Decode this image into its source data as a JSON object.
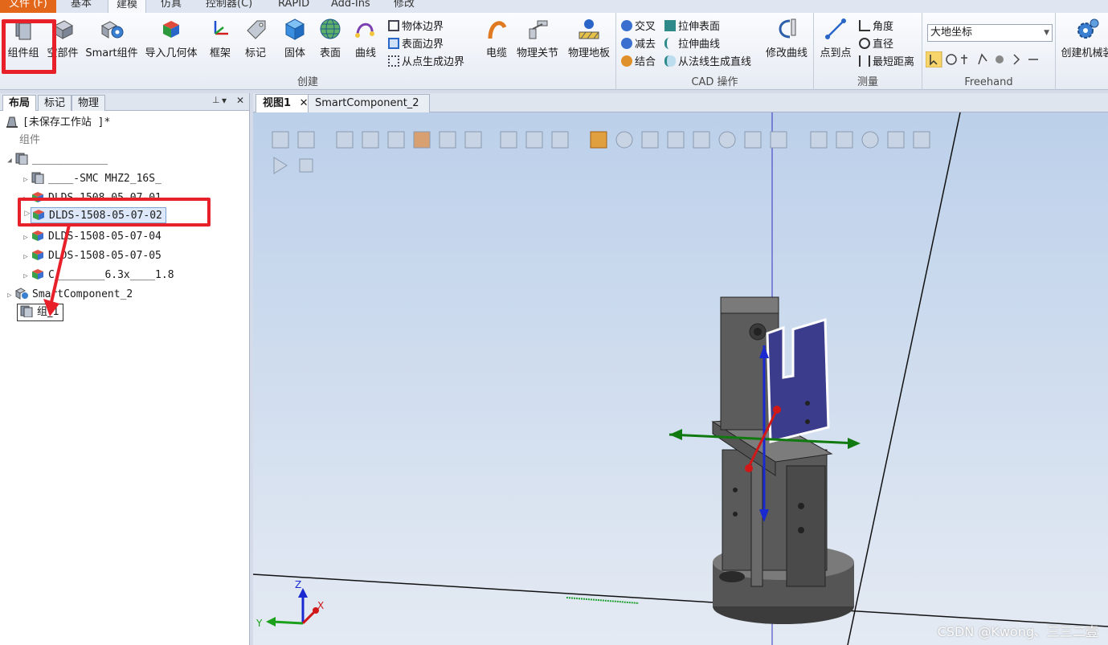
{
  "menu_tabs": [
    {
      "label": "文件 (F)"
    },
    {
      "label": "基本"
    },
    {
      "label": "建模"
    },
    {
      "label": "仿真"
    },
    {
      "label": "控制器(C)"
    },
    {
      "label": "RAPID"
    },
    {
      "label": "Add-Ins"
    },
    {
      "label": "修改"
    }
  ],
  "ribbon": {
    "create": {
      "label": "创建",
      "buttons": [
        "组件组",
        "空部件",
        "Smart组件",
        "导入几何体",
        "框架",
        "标记",
        "固体",
        "表面",
        "曲线"
      ],
      "small": [
        "物体边界",
        "表面边界",
        "从点生成边界"
      ],
      "physics": [
        "电缆",
        "物理关节",
        "物理地板"
      ]
    },
    "cad": {
      "label": "CAD 操作",
      "small_left": [
        "交叉",
        "减去",
        "结合"
      ],
      "small_right": [
        "拉伸表面",
        "拉伸曲线",
        "从法线生成直线"
      ],
      "modify": "修改曲线"
    },
    "measure": {
      "label": "测量",
      "point_to_point": "点到点",
      "small": [
        "角度",
        "直径",
        "最短距离"
      ]
    },
    "freehand": {
      "label": "Freehand",
      "coord_select": "大地坐标"
    },
    "mechanism": "创建机械装"
  },
  "left_panel": {
    "tabs": [
      "布局",
      "标记",
      "物理"
    ],
    "pin": "▾",
    "pin_extra": "⊥",
    "close": "✕",
    "tree": {
      "station": "[未保存工作站 ]*",
      "components_label": "组件",
      "group_node": "____________",
      "children": [
        "____-SMC MHZ2_16S_",
        "DLDS-1508-05-07-01",
        "DLDS-1508-05-07-02",
        "DLDS-1508-05-07-04",
        "DLDS-1508-05-07-05",
        "C________6.3x____1.8"
      ],
      "smart_component": "SmartComponent_2",
      "new_group": "组_1"
    }
  },
  "view_tabs": [
    {
      "label": "视图1"
    },
    {
      "label": "SmartComponent_2"
    }
  ],
  "view_tab_close": "✕",
  "axis_labels": {
    "x": "X",
    "y": "Y",
    "z": "Z"
  },
  "watermark": "CSDN @Kwong、三三二壹",
  "colors": {
    "file_tab": "#e2671b",
    "highlight": "#e8202a",
    "gripper_body": "#5a5a5a",
    "finger_selected": "#3c3c8c"
  }
}
